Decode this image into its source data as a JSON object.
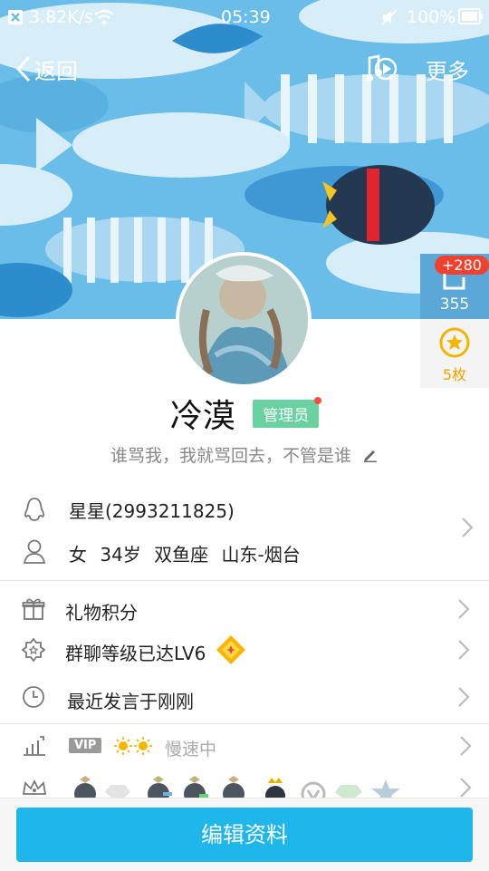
{
  "status_bar": {
    "speed": "3.82K/s",
    "time": "05:39",
    "battery": "100%"
  },
  "nav": {
    "back_label": "返回",
    "more_label": "更多"
  },
  "side_badges": {
    "likes_delta": "+280",
    "likes_count": "355",
    "medals": "5枚"
  },
  "profile": {
    "name": "冷漠",
    "role_badge": "管理员",
    "signature": "谁骂我，我就骂回去，不管是谁"
  },
  "info": {
    "qq": "星星(2993211825)",
    "gender": "女",
    "age": "34岁",
    "zodiac": "双鱼座",
    "location": "山东-烟台"
  },
  "menu": {
    "gift_points": "礼物积分",
    "group_level": "群聊等级已达LV6",
    "last_speak": "最近发言于刚刚"
  },
  "vip_row": {
    "vip_label": "VIP",
    "speed_status": "慢速中"
  },
  "footer": {
    "edit_button": "编辑资料"
  },
  "colors": {
    "accent": "#1fb6ec",
    "admin_badge": "#6ad1a0",
    "notify_red": "#f0412f",
    "banner_sky": "#64b8e6"
  }
}
